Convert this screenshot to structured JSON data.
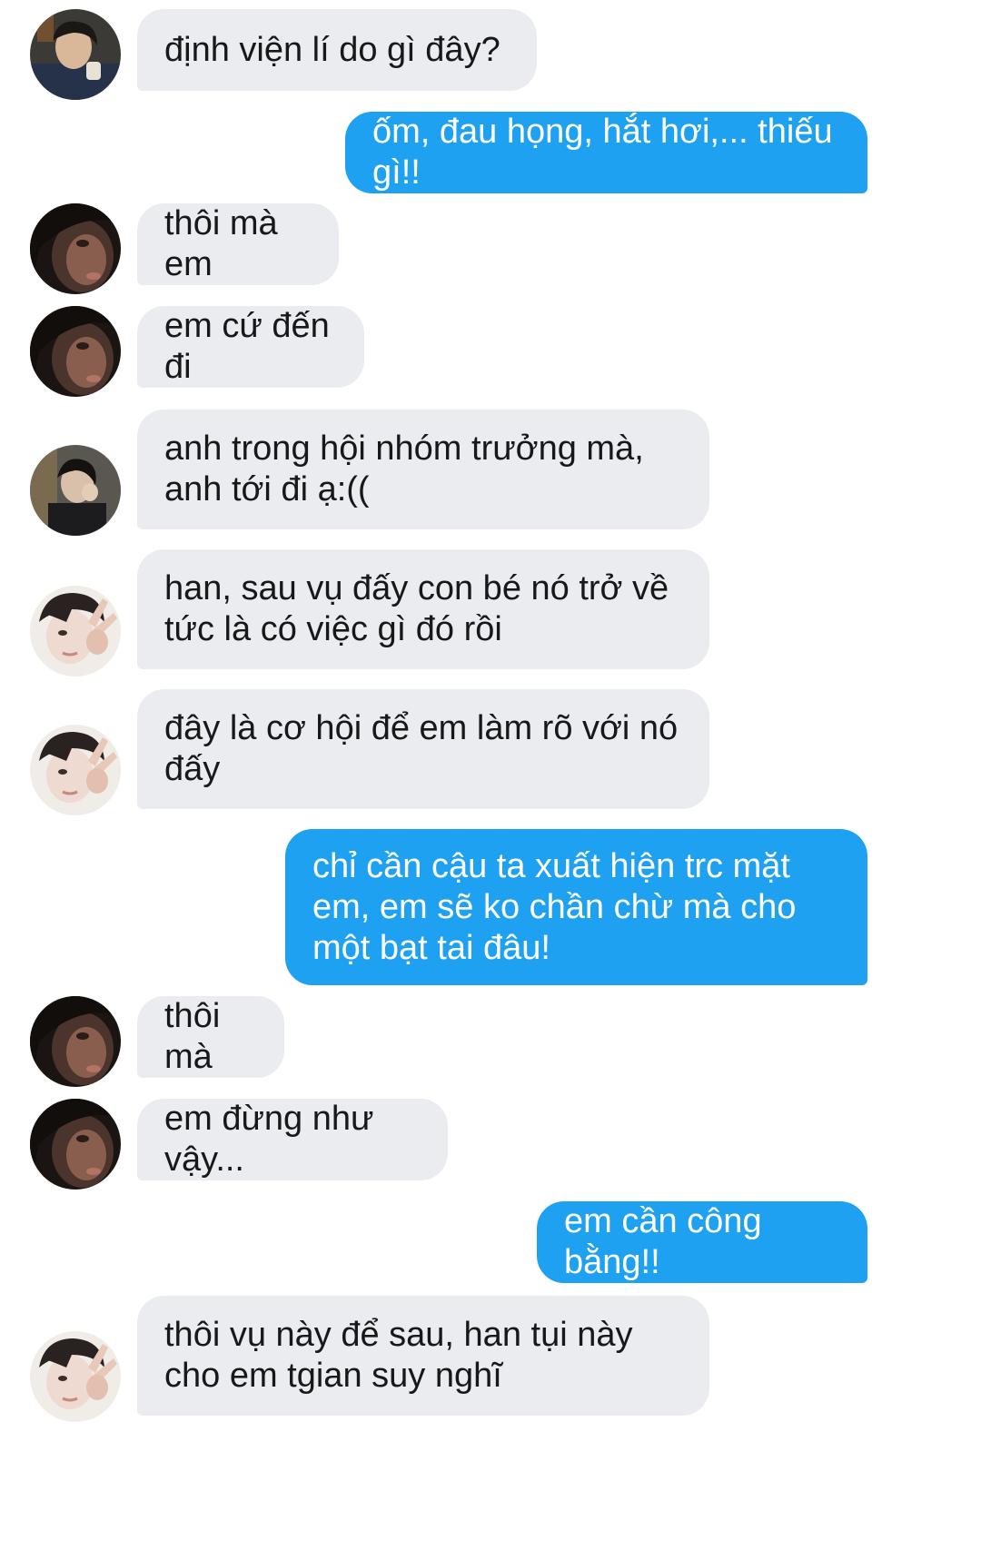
{
  "conversation": {
    "messages": [
      {
        "side": "in",
        "avatar": "boy-selfie",
        "text": "định viện lí do gì đây?"
      },
      {
        "side": "out",
        "text": "ốm, đau họng, hắt hơi,... thiếu gì!!"
      },
      {
        "side": "in",
        "avatar": "dark-face",
        "text": "thôi mà em"
      },
      {
        "side": "in",
        "avatar": "dark-face",
        "text": "em cứ đến đi"
      },
      {
        "side": "in",
        "avatar": "boy-peace-dark",
        "text": "anh trong hội nhóm trưởng mà, anh tới đi ạ:(("
      },
      {
        "side": "in",
        "avatar": "boy-peace",
        "text": "han, sau vụ đấy con bé nó trở về tức là có việc gì đó rồi"
      },
      {
        "side": "in",
        "avatar": "boy-peace",
        "text": "đây là cơ hội để em làm rõ với nó đấy"
      },
      {
        "side": "out",
        "text": "chỉ cần cậu ta xuất hiện trc mặt em, em sẽ ko chần chừ mà cho một bạt tai đâu!"
      },
      {
        "side": "in",
        "avatar": "dark-face",
        "text": "thôi mà"
      },
      {
        "side": "in",
        "avatar": "dark-face",
        "text": "em đừng như vậy..."
      },
      {
        "side": "out",
        "text": "em cần công bằng!!"
      },
      {
        "side": "in",
        "avatar": "boy-peace",
        "text": "thôi vụ này để sau, han tụi này cho em tgian suy nghĩ"
      }
    ]
  },
  "colors": {
    "incoming_bubble": "#eaecf0",
    "outgoing_bubble": "#1ea1f1",
    "incoming_text": "#17181a",
    "outgoing_text": "#ffffff"
  }
}
